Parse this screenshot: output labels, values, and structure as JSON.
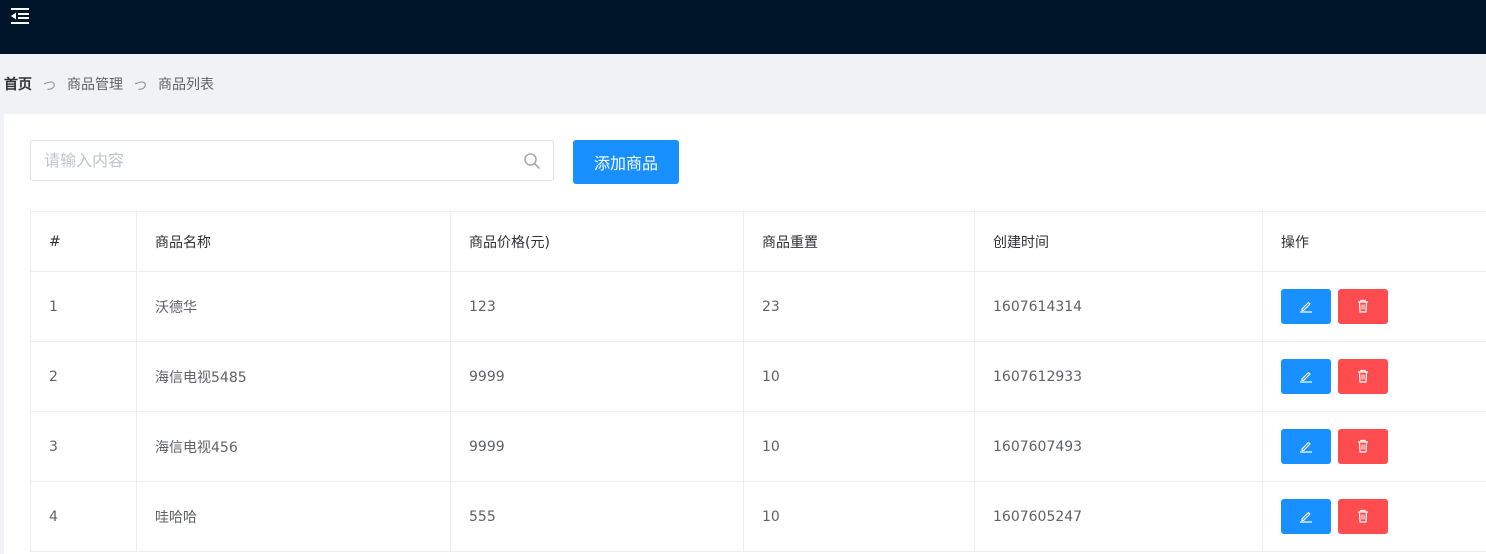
{
  "topbar": {
    "menu_toggle_icon": "menu-fold-icon",
    "background": "#001529"
  },
  "breadcrumb": {
    "home": "首页",
    "separator": "つ",
    "level1": "商品管理",
    "level2": "商品列表"
  },
  "toolbar": {
    "search_placeholder": "请输入内容",
    "search_value": "",
    "search_icon": "search-icon",
    "add_label": "添加商品",
    "accent": "#1890ff"
  },
  "table": {
    "columns": [
      "#",
      "商品名称",
      "商品价格(元)",
      "商品重置",
      "创建时间",
      "操作"
    ],
    "rows": [
      {
        "index": "1",
        "name": "沃德华",
        "price": "123",
        "weight": "23",
        "created": "1607614314"
      },
      {
        "index": "2",
        "name": "海信电视5485",
        "price": "9999",
        "weight": "10",
        "created": "1607612933"
      },
      {
        "index": "3",
        "name": "海信电视456",
        "price": "9999",
        "weight": "10",
        "created": "1607607493"
      },
      {
        "index": "4",
        "name": "哇哈哈",
        "price": "555",
        "weight": "10",
        "created": "1607605247"
      }
    ],
    "edit_icon": "edit-icon",
    "delete_icon": "trash-icon",
    "edit_color": "#1890ff",
    "delete_color": "#ff4d4f"
  }
}
